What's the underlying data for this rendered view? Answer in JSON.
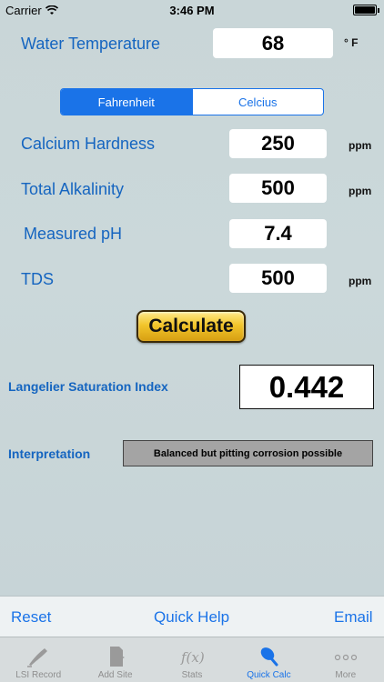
{
  "status_bar": {
    "carrier": "Carrier",
    "time": "3:46 PM",
    "battery_level": 1.0
  },
  "water_temperature": {
    "label": "Water Temperature",
    "value": "68",
    "unit": "° F"
  },
  "temp_unit_segment": {
    "options": [
      "Fahrenheit",
      "Celcius"
    ],
    "selected": "Fahrenheit"
  },
  "calcium_hardness": {
    "label": "Calcium Hardness",
    "value": "250",
    "unit": "ppm"
  },
  "total_alkalinity": {
    "label": "Total Alkalinity",
    "value": "500",
    "unit": "ppm"
  },
  "measured_ph": {
    "label": "Measured pH",
    "value": "7.4"
  },
  "tds": {
    "label": "TDS",
    "value": "500",
    "unit": "ppm"
  },
  "calculate_button": {
    "label": "Calculate"
  },
  "lsi": {
    "label": "Langelier Saturation Index",
    "value": "0.442"
  },
  "interpretation": {
    "label": "Interpretation",
    "value": "Balanced but pitting corrosion possible"
  },
  "toolbar": {
    "reset": "Reset",
    "quick_help": "Quick Help",
    "email": "Email"
  },
  "tabs": [
    {
      "label": "LSI Record",
      "icon": "pen-icon"
    },
    {
      "label": "Add Site",
      "icon": "document-add-icon"
    },
    {
      "label": "Stats",
      "icon": "function-icon"
    },
    {
      "label": "Quick Calc",
      "icon": "brush-icon"
    },
    {
      "label": "More",
      "icon": "more-icon"
    }
  ],
  "colors": {
    "accent": "#1a73e8",
    "label_blue": "#1565c0",
    "calculate_gold": "#f2c52b",
    "interp_gray": "#a4a4a4"
  }
}
